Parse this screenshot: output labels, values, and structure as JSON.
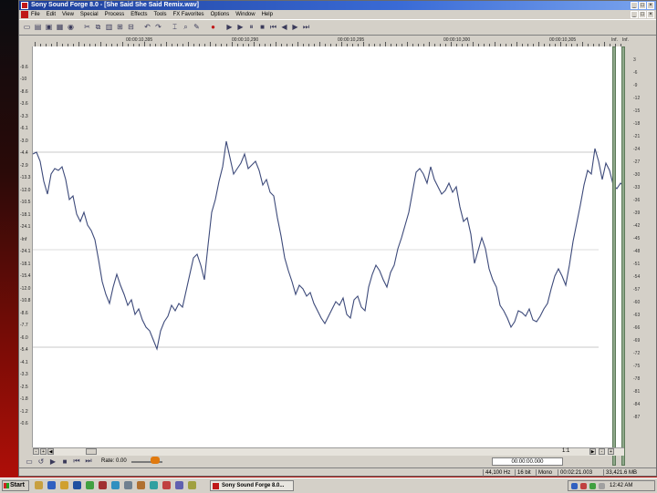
{
  "window": {
    "title": "Sony Sound Forge 8.0 - [She Said She Said Remix.wav]",
    "minimize_icon": "minimize-icon",
    "maximize_icon": "maximize-icon",
    "close_icon": "close-icon"
  },
  "menu": {
    "items": [
      "File",
      "Edit",
      "View",
      "Special",
      "Process",
      "Effects",
      "Tools",
      "FX Favorites",
      "Options",
      "Window",
      "Help"
    ]
  },
  "toolbar": {
    "icons": [
      "new-icon",
      "open-icon",
      "save-icon",
      "save-all-icon",
      "properties-icon",
      "cut-icon",
      "copy-icon",
      "paste-icon",
      "mix-icon",
      "trim-icon",
      "undo-icon",
      "redo-icon",
      "edit-tool-icon",
      "magnify-tool-icon",
      "pencil-tool-icon",
      "record-icon",
      "play-all-icon",
      "play-icon",
      "pause-icon",
      "stop-icon",
      "go-start-icon",
      "rewind-icon",
      "forward-icon",
      "go-end-icon"
    ]
  },
  "timeline": {
    "labels": [
      "00:00:10,395",
      "00:00:10,290",
      "00:00:10,295",
      "00:00:10,300",
      "00:00:10,305"
    ]
  },
  "db_ruler": {
    "labels": [
      "-9.6",
      "-10",
      "-8.6",
      "-3.6",
      "-3.3",
      "-6.1",
      "-3.0",
      "-4.4",
      "-2.9",
      "-13.3",
      "-12.0",
      "-10.5",
      "-18.1",
      "-24.1",
      "-Inf",
      "-24.1",
      "-18.1",
      "-15.4",
      "-12.0",
      "-10.8",
      "-8.6",
      "-7.7",
      "-6.0",
      "-5.4",
      "-4.1",
      "-3.3",
      "-2.5",
      "-1.8",
      "-1.2",
      "-0.6"
    ]
  },
  "meters": {
    "left_head": "Inf.",
    "right_head": "Inf.",
    "scale": [
      "3",
      "-6",
      "-9",
      "-12",
      "-15",
      "-18",
      "-21",
      "-24",
      "-27",
      "-30",
      "-33",
      "-36",
      "-39",
      "-42",
      "-45",
      "-48",
      "-51",
      "-54",
      "-57",
      "-60",
      "-63",
      "-66",
      "-69",
      "-72",
      "-75",
      "-78",
      "-81",
      "-84",
      "-87"
    ]
  },
  "transport": {
    "rate_label": "Rate: 0.00",
    "position": "00:00:00.000",
    "zoom_ratio": "1:1"
  },
  "status": {
    "sample_rate": "44,100 Hz",
    "bit_depth": "16 bit",
    "channels": "Mono",
    "length": "00:02:21.003",
    "free_space": "33,421.6 MB"
  },
  "taskbar": {
    "start_label": "Start",
    "task_label": "Sony Sound Forge 8.0...",
    "clock": "12:42 AM"
  }
}
